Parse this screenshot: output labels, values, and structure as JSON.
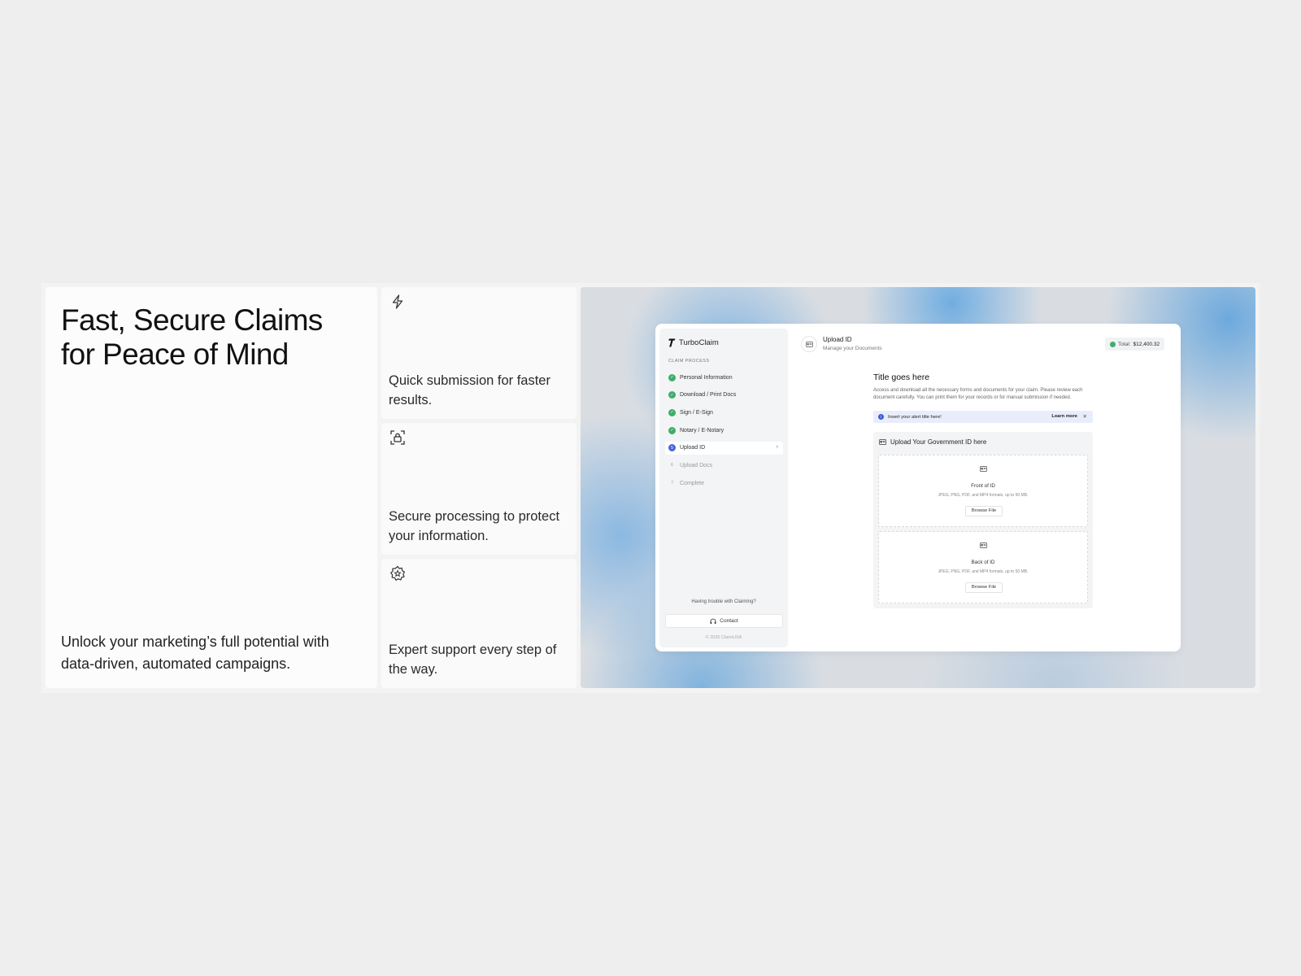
{
  "hero": {
    "title_line1": "Fast, Secure Claims",
    "title_line2": "for Peace of Mind",
    "subtitle": "Unlock your marketing’s full potential with data-driven, automated campaigns."
  },
  "features": [
    {
      "icon": "lightning-icon",
      "text": "Quick submission for faster results."
    },
    {
      "icon": "lock-scan-icon",
      "text": "Secure processing to protect your information."
    },
    {
      "icon": "badge-star-icon",
      "text": "Expert support every step of the way."
    }
  ],
  "app": {
    "brand": "TurboClaim",
    "section_label": "CLAIM PROCESS",
    "steps": [
      {
        "marker": "✓",
        "label": "Personal Information",
        "state": "done"
      },
      {
        "marker": "✓",
        "label": "Download / Print Docs",
        "state": "done"
      },
      {
        "marker": "✓",
        "label": "Sign / E-Sign",
        "state": "done"
      },
      {
        "marker": "✓",
        "label": "Notary / E-Notary",
        "state": "done"
      },
      {
        "marker": "5",
        "label": "Upload ID",
        "state": "active"
      },
      {
        "marker": "6",
        "label": "Upload Docs",
        "state": "todo"
      },
      {
        "marker": "7",
        "label": "Complete",
        "state": "todo"
      }
    ],
    "help_text": "Having trouble with Claiming?",
    "contact_label": "Contact",
    "copyright": "© 2025 ClaimUSA",
    "topbar": {
      "title": "Upload ID",
      "subtitle": "Manage your Documents",
      "total_label": "Total:",
      "total_value": "$12,400.32"
    },
    "main": {
      "title": "Title goes here",
      "description": "Access and download all the necessary forms and documents for your claim. Please review each document carefully. You can print them for your records or for manual submission if needed.",
      "alert_text": "Insert your alert title here!",
      "alert_link": "Learn more",
      "upload_heading": "Upload Your Government ID here",
      "front_label": "Front of ID",
      "back_label": "Back of ID",
      "formats_hint": "JPEG, PNG, PDF, and MP4 formats, up to 50 MB.",
      "browse_label": "Browse File"
    }
  },
  "colors": {
    "success": "#3fae68",
    "accent": "#4a63d8",
    "alert_bg": "#e9edfb"
  }
}
